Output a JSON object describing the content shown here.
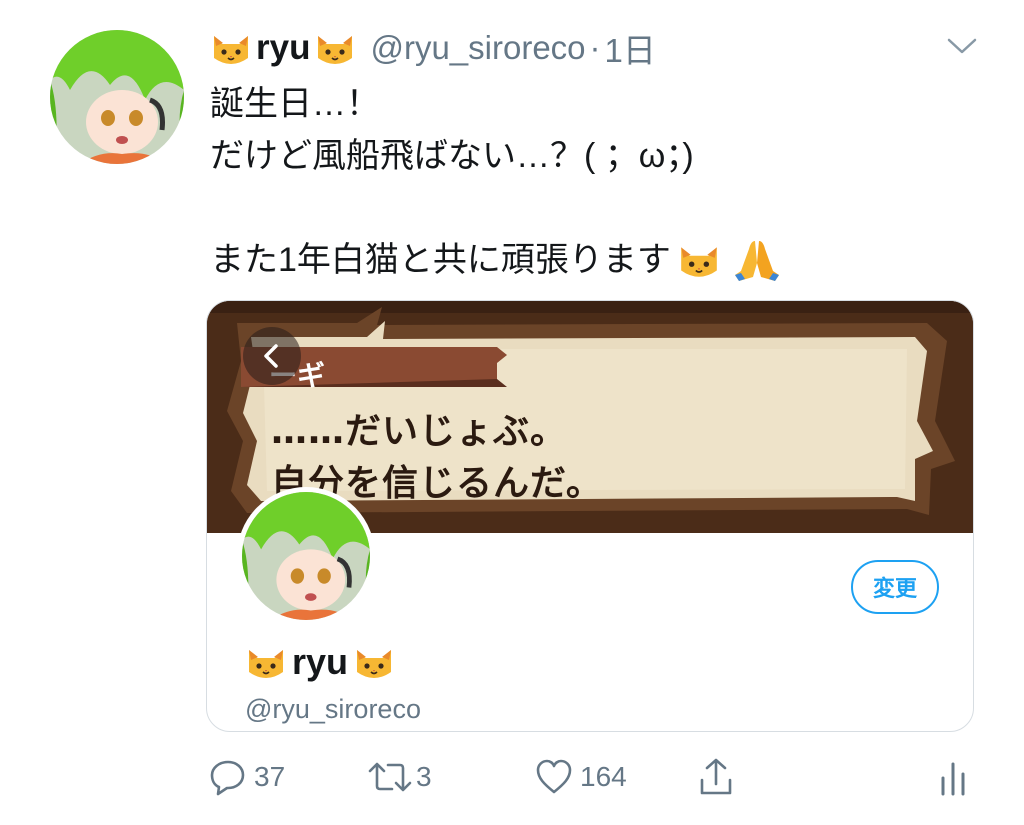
{
  "tweet": {
    "author": {
      "display_name": "ryu",
      "name_emoji": "cat-face",
      "handle": "@ryu_siroreco"
    },
    "separator": "·",
    "time": "1日",
    "body": {
      "line1": "誕生日…！",
      "line2": "だけど風船飛ばない…？(  ；ω；)",
      "line3": "また1年白猫と共に頑張ります",
      "line3_emojis": [
        "cat-face",
        "folded-hands"
      ]
    },
    "card": {
      "dialog_title": "ーギ",
      "dialog_line1": "……だいじょぶ。",
      "dialog_line2": "自分を信じるんだ。",
      "edit_label": "変更",
      "display_name": "ryu",
      "handle": "@ryu_siroreco"
    },
    "actions": {
      "reply_count": "37",
      "retweet_count": "3",
      "like_count": "164",
      "share_icon": "share-icon",
      "analytics_icon": "analytics-icon"
    },
    "colors": {
      "accent": "#1da1f2",
      "secondary_text": "#657786",
      "banner": "#4a2a17"
    }
  }
}
